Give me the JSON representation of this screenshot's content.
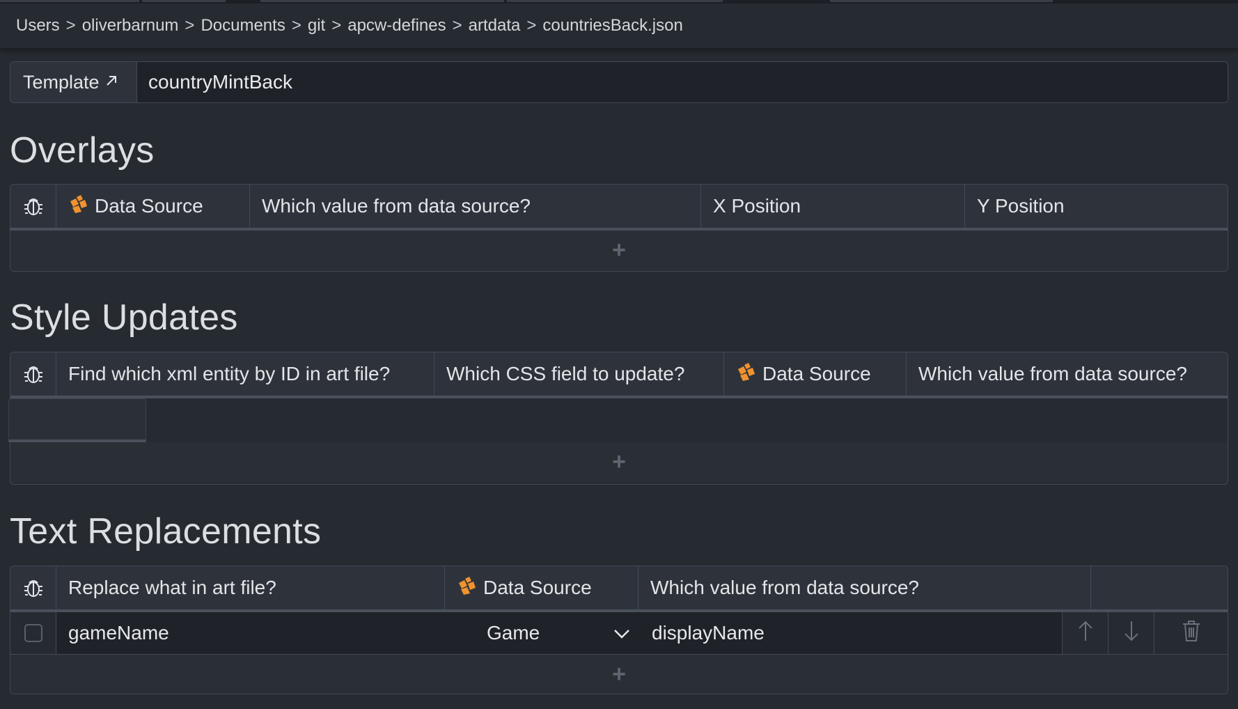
{
  "breadcrumb": [
    "Users",
    "oliverbarnum",
    "Documents",
    "git",
    "apcw-defines",
    "artdata",
    "countriesBack.json"
  ],
  "breadcrumb_separator": ">",
  "template": {
    "label": "Template",
    "link_icon": "external-link-icon",
    "value": "countryMintBack"
  },
  "overlays": {
    "title": "Overlays",
    "columns": [
      "Data Source",
      "Which value from data source?",
      "X Position",
      "Y Position"
    ],
    "add_label": "+"
  },
  "style_updates": {
    "title": "Style Updates",
    "columns": [
      "Find which xml entity by ID in art file?",
      "Which CSS field to update?",
      "Data Source",
      "Which value from data source?"
    ],
    "add_label": "+"
  },
  "text_replacements": {
    "title": "Text Replacements",
    "columns": [
      "Replace what in art file?",
      "Data Source",
      "Which value from data source?"
    ],
    "rows": [
      {
        "replace": "gameName",
        "data_source": "Game",
        "value": "displayName"
      }
    ],
    "add_label": "+"
  },
  "colors": {
    "accent": "#f0922e",
    "background": "#262a31",
    "input_bg": "#1f2228",
    "border": "#434955"
  },
  "icons": [
    "bug-icon",
    "data-source-icon",
    "chevron-down-icon",
    "arrow-up-icon",
    "arrow-down-icon",
    "trash-icon",
    "external-link-icon",
    "plus-icon"
  ]
}
